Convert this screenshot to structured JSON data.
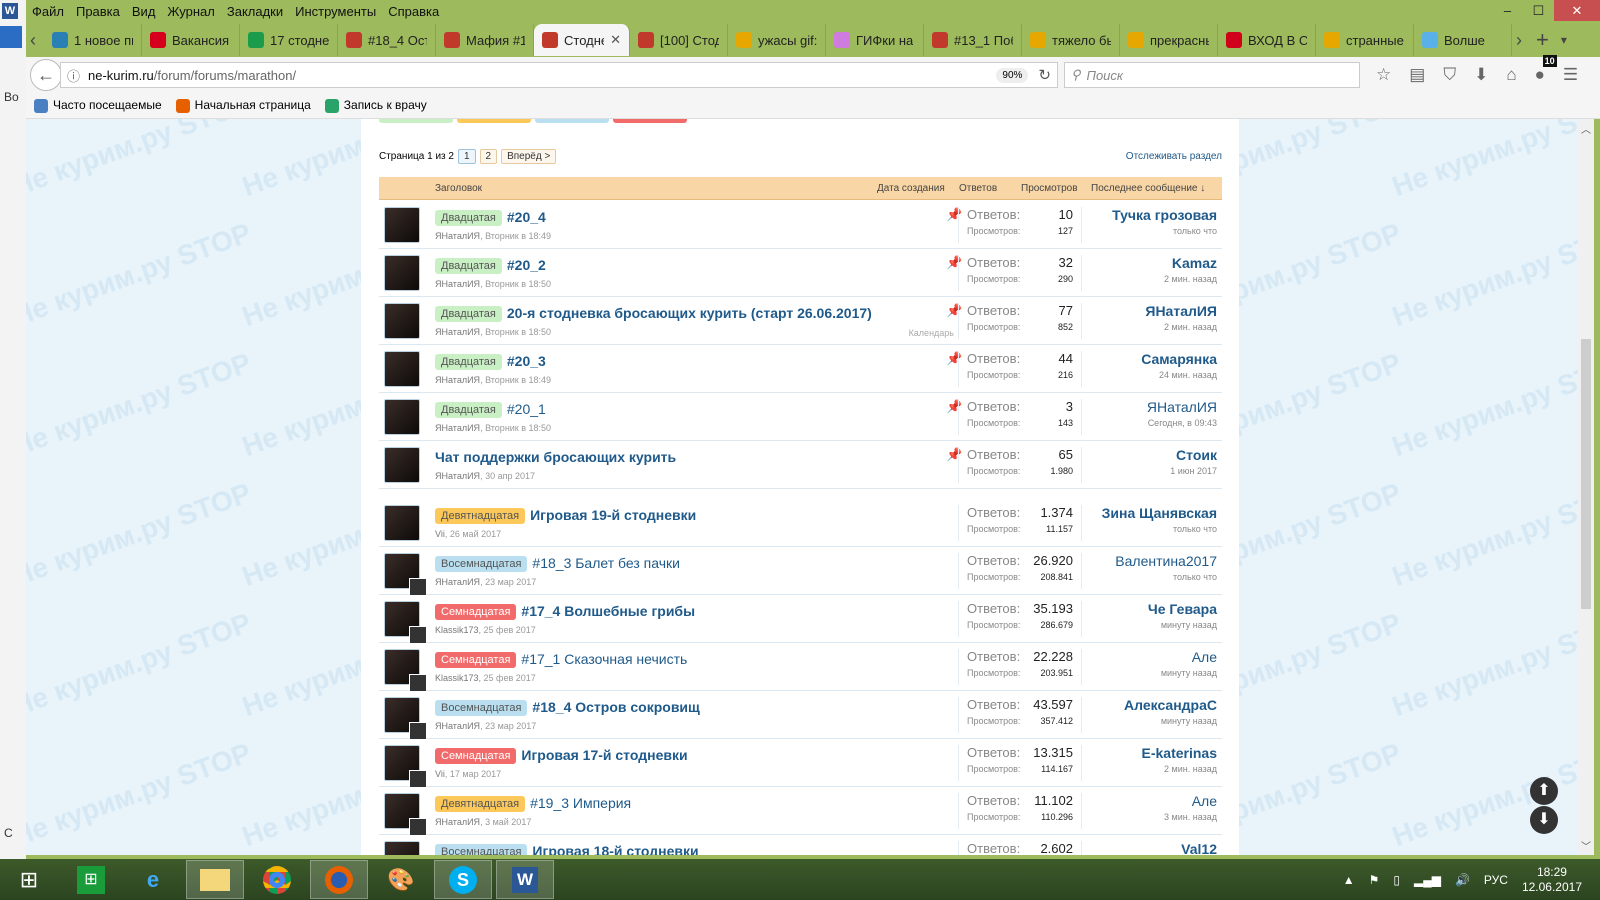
{
  "background_window": {
    "app_letter": "W",
    "text_1": "Во",
    "text_2": "С"
  },
  "menu": [
    "Файл",
    "Правка",
    "Вид",
    "Журнал",
    "Закладки",
    "Инструменты",
    "Справка"
  ],
  "window_controls": {
    "minimize": "–",
    "maximize": "☐",
    "close": "✕"
  },
  "tabs": [
    {
      "label": "1 новое пи",
      "color": "#2a7fb5"
    },
    {
      "label": "Вакансия д",
      "color": "#d6001c"
    },
    {
      "label": "17 стоднев",
      "color": "#1a9c4a"
    },
    {
      "label": "#18_4 Остр",
      "color": "#c0392b"
    },
    {
      "label": "Мафия #1",
      "color": "#c0392b"
    },
    {
      "label": "Стодне",
      "color": "#c0392b",
      "active": true,
      "close": "✕"
    },
    {
      "label": "[100] Стод",
      "color": "#c0392b"
    },
    {
      "label": "ужасы gif:",
      "color": "#e6a700"
    },
    {
      "label": "ГИФки на",
      "color": "#d07be0"
    },
    {
      "label": "#13_1 Поб",
      "color": "#c0392b"
    },
    {
      "label": "тяжело бы",
      "color": "#e6a700"
    },
    {
      "label": "прекрасны",
      "color": "#e6a700"
    },
    {
      "label": "ВХОД В СИ",
      "color": "#d0021b"
    },
    {
      "label": "странные",
      "color": "#e6a700"
    },
    {
      "label": "Волше",
      "color": "#5ab0e8"
    }
  ],
  "tab_controls": {
    "scroll_left": "‹",
    "scroll_right": "›",
    "new_tab": "+",
    "list": "▾"
  },
  "nav": {
    "back": "←",
    "info": "ⓘ",
    "url_host": "ne-kurim.ru",
    "url_path": "/forum/forums/marathon/",
    "zoom": "90%",
    "reload": "↻",
    "search_placeholder": "Поиск",
    "notification_count": "10"
  },
  "toolbar_icons": [
    "star-icon",
    "reading-list-icon",
    "pocket-icon",
    "download-icon",
    "home-icon",
    "sync-icon",
    "menu-icon"
  ],
  "bookmarks": [
    {
      "label": "Часто посещаемые",
      "color": "#4a7fc1"
    },
    {
      "label": "Начальная страница",
      "color": "#e66000"
    },
    {
      "label": "Запись к врачу",
      "color": "#2aa36b"
    }
  ],
  "forum": {
    "prefix_colors": {
      "Двадцатая": "#c9efc4",
      "Девятнадцатая": "#fcc85a",
      "Восемнадцатая": "#b9dff0",
      "Семнадцатая": "#f26b6b"
    },
    "pager": {
      "label": "Страница 1 из 2",
      "pages": [
        "1",
        "2"
      ],
      "next": "Вперёд >"
    },
    "follow": "Отслеживать раздел",
    "columns": {
      "title": "Заголовок",
      "created": "Дата создания",
      "replies": "Ответов",
      "views": "Просмотров",
      "last": "Последнее сообщение ↓"
    },
    "replies_label": "Ответов:",
    "views_label": "Просмотров:",
    "threads": [
      {
        "prefix": "Двадцатая",
        "title": "#20_4",
        "bold": true,
        "author": "ЯНаталИЯ",
        "date": "Вторник в 18:49",
        "pinned": true,
        "replies": "10",
        "views": "127",
        "last_user": "Тучка грозовая",
        "last_bold": true,
        "last_time": "только что"
      },
      {
        "prefix": "Двадцатая",
        "title": "#20_2",
        "bold": true,
        "author": "ЯНаталИЯ",
        "date": "Вторник в 18:50",
        "pinned": true,
        "replies": "32",
        "views": "290",
        "last_user": "Kamaz",
        "last_bold": true,
        "last_time": "2 мин. назад"
      },
      {
        "prefix": "Двадцатая",
        "title": "20-я стодневка бросающих курить (старт 26.06.2017)",
        "bold": true,
        "author": "ЯНаталИЯ",
        "date": "Вторник в 18:50",
        "pinned": true,
        "extra": "Календарь",
        "replies": "77",
        "views": "852",
        "last_user": "ЯНаталИЯ",
        "last_bold": true,
        "last_time": "2 мин. назад"
      },
      {
        "prefix": "Двадцатая",
        "title": "#20_3",
        "bold": true,
        "author": "ЯНаталИЯ",
        "date": "Вторник в 18:49",
        "pinned": true,
        "replies": "44",
        "views": "216",
        "last_user": "Самарянка",
        "last_bold": true,
        "last_time": "24 мин. назад"
      },
      {
        "prefix": "Двадцатая",
        "title": "#20_1",
        "bold": false,
        "author": "ЯНаталИЯ",
        "date": "Вторник в 18:50",
        "pinned": true,
        "replies": "3",
        "views": "143",
        "last_user": "ЯНаталИЯ",
        "last_bold": false,
        "last_time": "Сегодня, в 09:43"
      },
      {
        "prefix": "",
        "title": "Чат поддержки бросающих курить",
        "bold": true,
        "author": "ЯНаталИЯ",
        "date": "30 апр 2017",
        "pinned": true,
        "replies": "65",
        "views": "1.980",
        "last_user": "Стоик",
        "last_bold": true,
        "last_time": "1 июн 2017"
      },
      {
        "prefix": "Девятнадцатая",
        "title": "Игровая 19-й стодневки",
        "bold": true,
        "author": "Vii",
        "date": "26 май 2017",
        "replies": "1.374",
        "views": "11.157",
        "last_user": "Зина Щанявская",
        "last_bold": true,
        "last_time": "только что",
        "gap": true
      },
      {
        "prefix": "Восемнадцатая",
        "title": "#18_3 Балет без пачки",
        "bold": false,
        "author": "ЯНаталИЯ",
        "date": "23 мар 2017",
        "replies": "26.920",
        "views": "208.841",
        "last_user": "Валентина2017",
        "last_bold": false,
        "last_time": "только что",
        "mini": true
      },
      {
        "prefix": "Семнадцатая",
        "title": "#17_4 Волшебные грибы",
        "bold": true,
        "author": "Klassik173",
        "date": "25 фев 2017",
        "replies": "35.193",
        "views": "286.679",
        "last_user": "Че Гевара",
        "last_bold": true,
        "last_time": "минуту назад",
        "mini": true
      },
      {
        "prefix": "Семнадцатая",
        "title": "#17_1 Сказочная нечисть",
        "bold": false,
        "author": "Klassik173",
        "date": "25 фев 2017",
        "replies": "22.228",
        "views": "203.951",
        "last_user": "Але",
        "last_bold": false,
        "last_time": "минуту назад",
        "mini": true
      },
      {
        "prefix": "Восемнадцатая",
        "title": "#18_4 Остров сокровищ",
        "bold": true,
        "author": "ЯНаталИЯ",
        "date": "23 мар 2017",
        "replies": "43.597",
        "views": "357.412",
        "last_user": "АлександраС",
        "last_bold": true,
        "last_time": "минуту назад",
        "mini": true
      },
      {
        "prefix": "Семнадцатая",
        "title": "Игровая 17-й стодневки",
        "bold": true,
        "author": "Vii",
        "date": "17 мар 2017",
        "replies": "13.315",
        "views": "114.167",
        "last_user": "E-katerinas",
        "last_bold": true,
        "last_time": "2 мин. назад",
        "mini": true
      },
      {
        "prefix": "Девятнадцатая",
        "title": "#19_3 Империя",
        "bold": false,
        "author": "ЯНаталИЯ",
        "date": "3 май 2017",
        "replies": "11.102",
        "views": "110.296",
        "last_user": "Але",
        "last_bold": false,
        "last_time": "3 мин. назад",
        "mini": true
      },
      {
        "prefix": "Восемнадцатая",
        "title": "Игровая 18-й стодневки",
        "bold": true,
        "author": "",
        "date": "",
        "replies": "2.602",
        "views": "",
        "last_user": "Val12",
        "last_bold": true,
        "last_time": ""
      }
    ]
  },
  "page_scroll": {
    "up": "⬆",
    "down": "⬇"
  },
  "watermark": "Не курим.ру STOP",
  "taskbar": {
    "apps": [
      "start",
      "store",
      "ie",
      "explorer",
      "chrome",
      "firefox",
      "paint",
      "skype",
      "word"
    ],
    "lang": "РУС",
    "time": "18:29",
    "date": "12.06.2017"
  }
}
